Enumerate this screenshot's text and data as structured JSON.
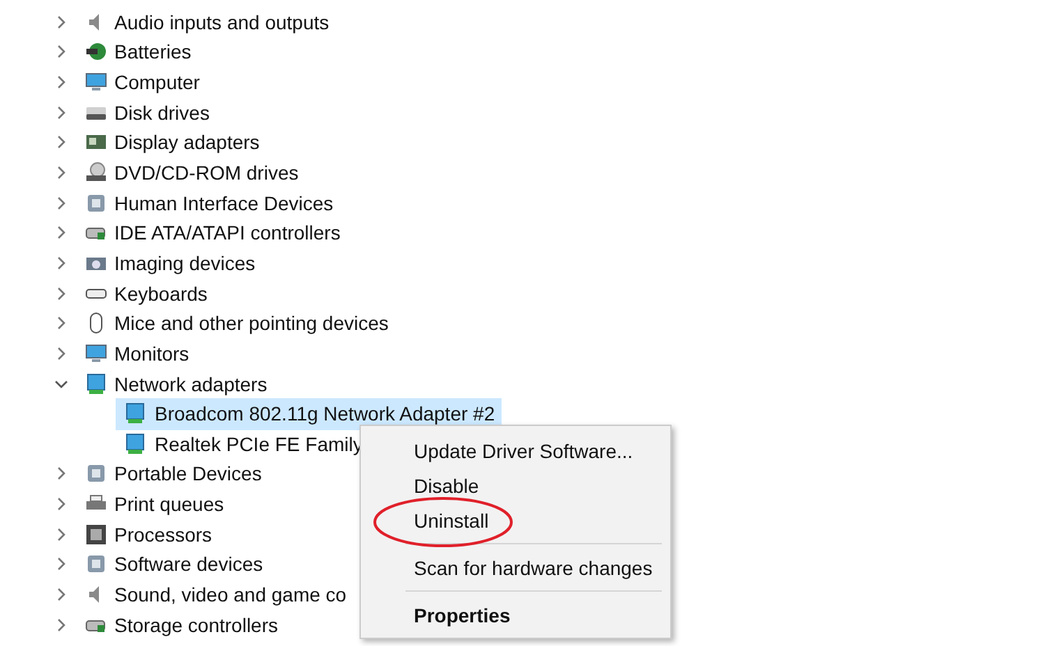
{
  "tree": [
    {
      "label": "Audio inputs and outputs",
      "expanded": false
    },
    {
      "label": "Batteries",
      "expanded": false
    },
    {
      "label": "Computer",
      "expanded": false
    },
    {
      "label": "Disk drives",
      "expanded": false
    },
    {
      "label": "Display adapters",
      "expanded": false
    },
    {
      "label": "DVD/CD-ROM drives",
      "expanded": false
    },
    {
      "label": "Human Interface Devices",
      "expanded": false
    },
    {
      "label": "IDE ATA/ATAPI controllers",
      "expanded": false
    },
    {
      "label": "Imaging devices",
      "expanded": false
    },
    {
      "label": "Keyboards",
      "expanded": false
    },
    {
      "label": "Mice and other pointing devices",
      "expanded": false
    },
    {
      "label": "Monitors",
      "expanded": false
    },
    {
      "label": "Network adapters",
      "expanded": true,
      "children": [
        {
          "label": "Broadcom 802.11g Network Adapter #2",
          "selected": true
        },
        {
          "label": "Realtek PCIe FE Family",
          "selected": false
        }
      ]
    },
    {
      "label": "Portable Devices",
      "expanded": false
    },
    {
      "label": "Print queues",
      "expanded": false
    },
    {
      "label": "Processors",
      "expanded": false
    },
    {
      "label": "Software devices",
      "expanded": false
    },
    {
      "label": "Sound, video and game co",
      "expanded": false
    },
    {
      "label": "Storage controllers",
      "expanded": false
    }
  ],
  "context_menu": [
    {
      "kind": "item",
      "label": "Update Driver Software...",
      "default": false,
      "circled": false
    },
    {
      "kind": "item",
      "label": "Disable",
      "default": false,
      "circled": false
    },
    {
      "kind": "item",
      "label": "Uninstall",
      "default": false,
      "circled": true
    },
    {
      "kind": "separator"
    },
    {
      "kind": "item",
      "label": "Scan for hardware changes",
      "default": false,
      "circled": false
    },
    {
      "kind": "separator"
    },
    {
      "kind": "item",
      "label": "Properties",
      "default": true,
      "circled": false
    }
  ]
}
